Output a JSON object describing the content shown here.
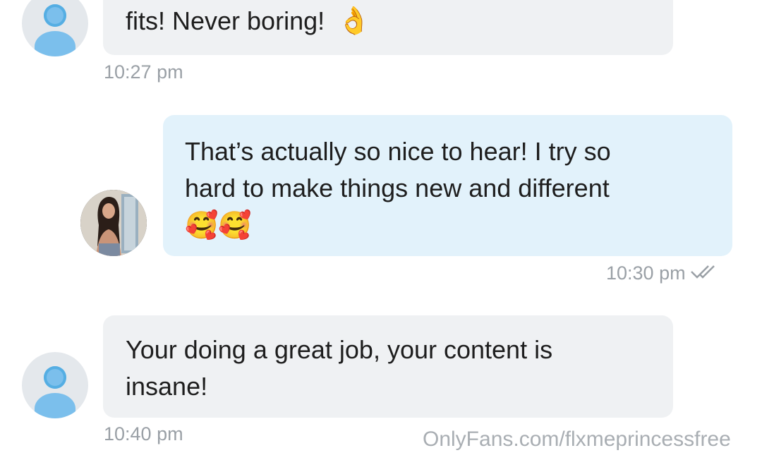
{
  "messages": [
    {
      "sender": "fan",
      "text": "fits! Never boring!",
      "emoji": "👌",
      "emoji_icon": "ok-hand-emoji",
      "time": "10:27 pm"
    },
    {
      "sender": "creator",
      "text_line1": "That’s actually so nice to hear! I try so",
      "text_line2": "hard to make things new and different",
      "emoji": "🥰🥰",
      "emoji_icon": "smiling-face-with-hearts-emoji",
      "time": "10:30 pm",
      "status_icon": "double-check-icon"
    },
    {
      "sender": "fan",
      "text_line1": "Your doing a great job, your content is",
      "text_line2": "insane!",
      "time": "10:40 pm"
    }
  ],
  "watermark": "OnlyFans.com/flxmeprincessfree",
  "colors": {
    "incoming_bubble": "#eff1f3",
    "outgoing_bubble": "#e2f2fb",
    "timestamp": "#9aa0a6",
    "avatar_accent": "#7bbfec"
  }
}
